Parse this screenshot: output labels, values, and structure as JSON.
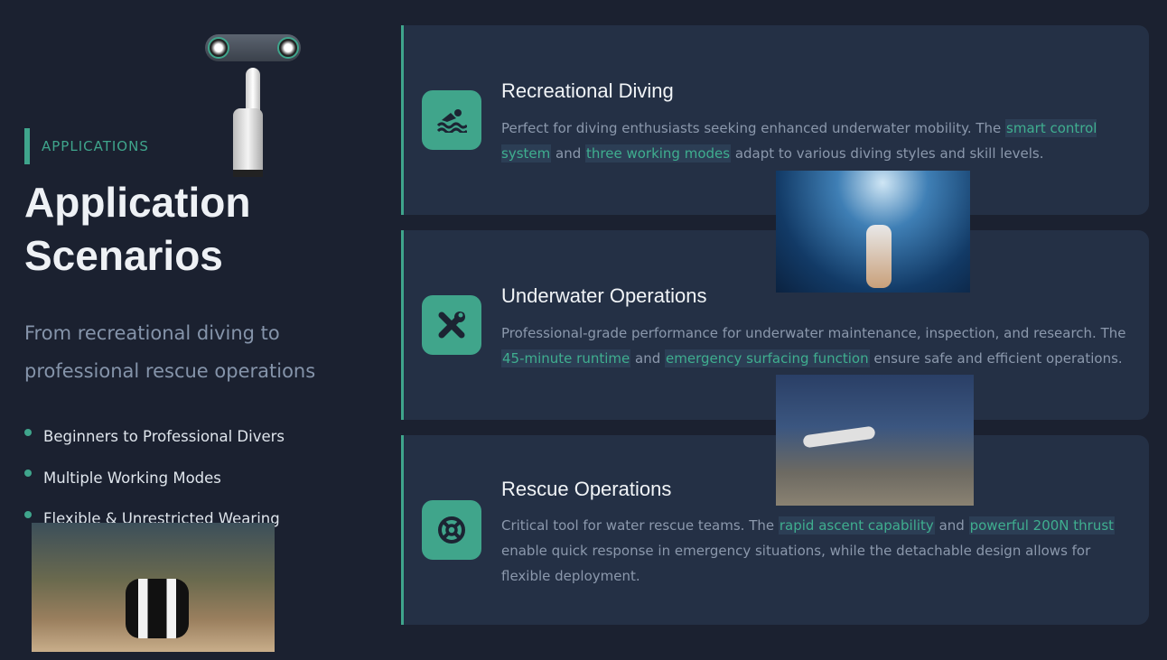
{
  "left": {
    "eyebrow": "APPLICATIONS",
    "title_line1": "Application",
    "title_line2": "Scenarios",
    "subtitle": "From recreational diving to professional rescue operations",
    "bullets": [
      "Beginners to Professional Divers",
      "Multiple Working Modes",
      "Flexible & Unrestricted Wearing"
    ]
  },
  "cards": [
    {
      "icon": "swimmer-icon",
      "title": "Recreational Diving",
      "segments": [
        "Perfect for diving enthusiasts seeking enhanced underwater mobility. The ",
        "smart control system",
        " and ",
        "three working modes",
        " adapt to various diving styles and skill levels."
      ]
    },
    {
      "icon": "tools-icon",
      "title": "Underwater Operations",
      "segments": [
        "Professional-grade performance for underwater maintenance, inspection, and research. The ",
        "45-minute runtime",
        " and ",
        "emergency surfacing function",
        " ensure safe and efficient operations."
      ]
    },
    {
      "icon": "life-ring-icon",
      "title": "Rescue Operations",
      "segments": [
        "Critical tool for water rescue teams. The ",
        "rapid ascent capability",
        " and ",
        "powerful 200N thrust",
        " enable quick response in emergency situations, while the detachable design allows for flexible deployment."
      ]
    }
  ],
  "colors": {
    "accent": "#3fa58c",
    "background": "#1b2130",
    "card": "#243045"
  }
}
